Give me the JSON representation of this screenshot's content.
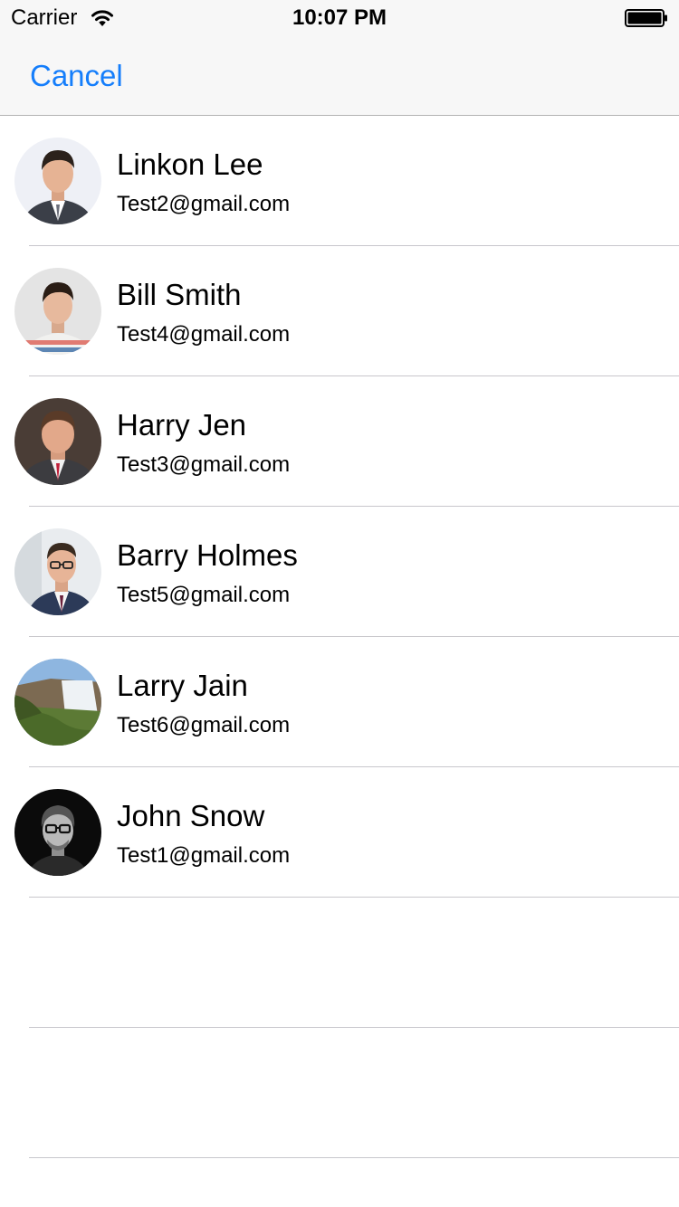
{
  "status_bar": {
    "carrier": "Carrier",
    "time": "10:07 PM"
  },
  "nav": {
    "cancel_label": "Cancel"
  },
  "colors": {
    "accent": "#157efb",
    "separator": "#c8c7cc",
    "bar_background": "#f7f7f7"
  },
  "contacts": [
    {
      "name": "Linkon Lee",
      "email": "Test2@gmail.com"
    },
    {
      "name": "Bill Smith",
      "email": "Test4@gmail.com"
    },
    {
      "name": "Harry Jen",
      "email": "Test3@gmail.com"
    },
    {
      "name": "Barry Holmes",
      "email": "Test5@gmail.com"
    },
    {
      "name": "Larry Jain",
      "email": "Test6@gmail.com"
    },
    {
      "name": "John Snow",
      "email": "Test1@gmail.com"
    }
  ]
}
